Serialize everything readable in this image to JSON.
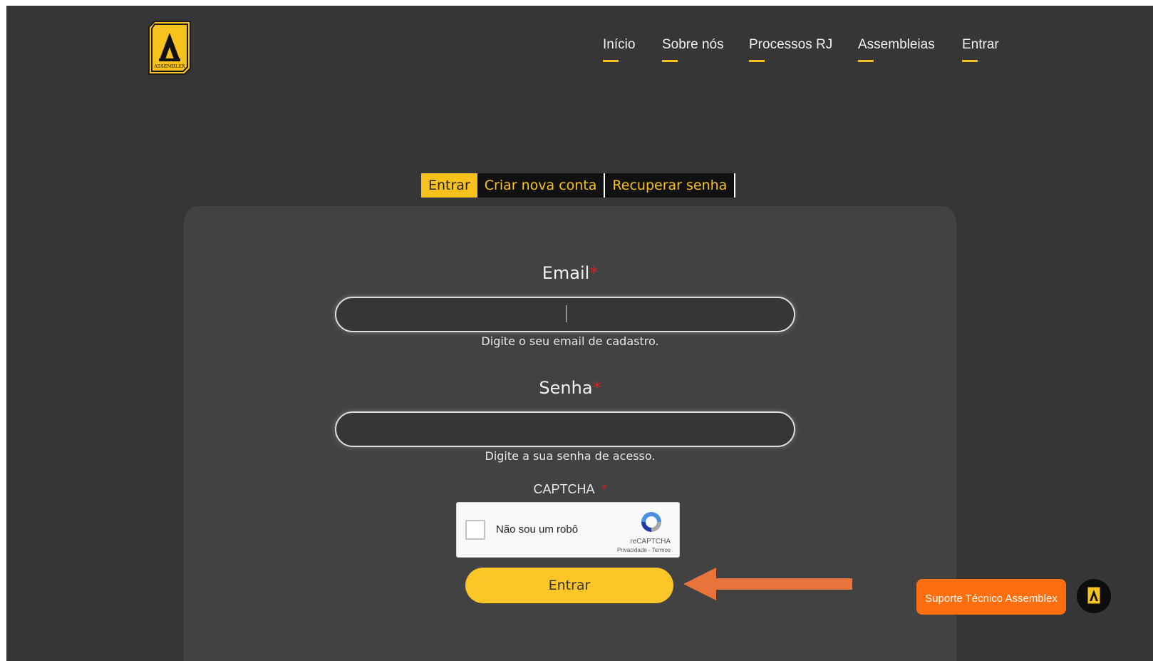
{
  "header": {
    "logo_text": "ASSEMBLEX",
    "nav": [
      {
        "label": "Início"
      },
      {
        "label": "Sobre nós"
      },
      {
        "label": "Processos RJ"
      },
      {
        "label": "Assembleias"
      },
      {
        "label": "Entrar"
      }
    ]
  },
  "tabs": [
    {
      "label": "Entrar",
      "active": true
    },
    {
      "label": "Criar nova conta",
      "active": false
    },
    {
      "label": "Recuperar senha",
      "active": false
    }
  ],
  "form": {
    "email": {
      "label": "Email",
      "required_mark": "*",
      "value": "",
      "hint": "Digite o seu email de cadastro."
    },
    "password": {
      "label": "Senha",
      "required_mark": "*",
      "value": "",
      "hint": "Digite a sua senha de acesso."
    },
    "captcha": {
      "label": "CAPTCHA",
      "required_mark": "*",
      "checkbox_label": "Não sou um robô",
      "brand": "reCAPTCHA",
      "privacy_link": "Privacidade",
      "separator": "-",
      "terms_link": "Termos"
    },
    "submit_label": "Entrar"
  },
  "support": {
    "label": "Suporte Técnico Assemblex"
  },
  "colors": {
    "background": "#363638",
    "card": "#424243",
    "accent": "#f7c21e",
    "button": "#fcc628",
    "support": "#ff6e0e",
    "annotation_arrow": "#e8743b",
    "required": "#e02020"
  },
  "icons": [
    "assemblex-logo-icon",
    "recaptcha-icon",
    "arrow-left-icon",
    "assemblex-avatar-icon"
  ]
}
